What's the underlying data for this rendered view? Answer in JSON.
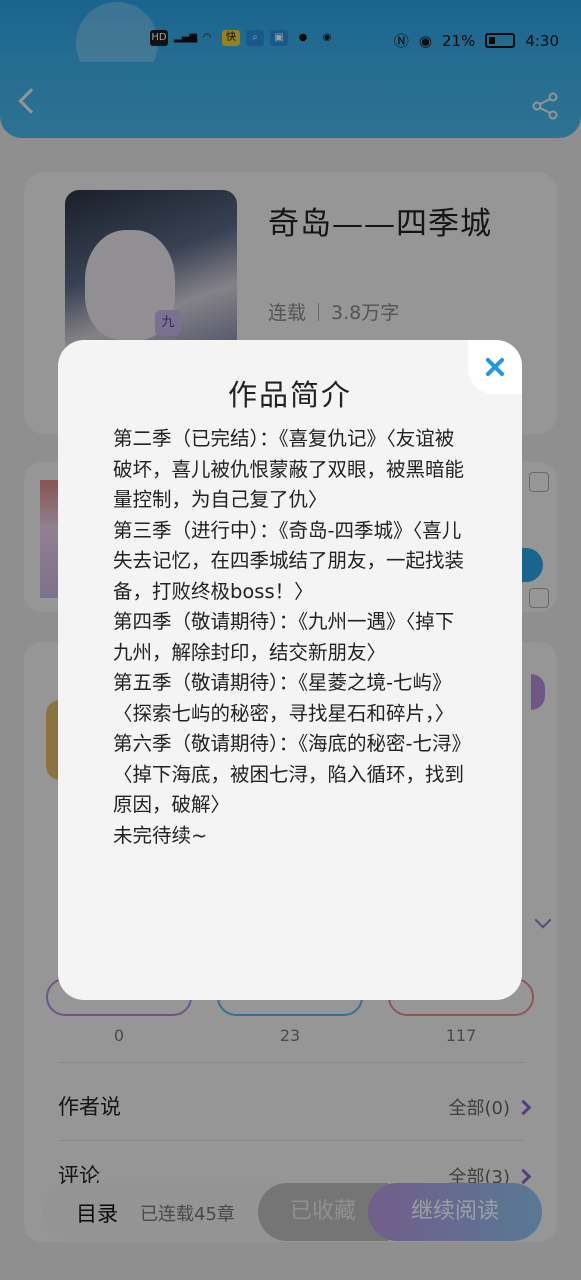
{
  "status_bar": {
    "time": "4:30",
    "battery": "21%",
    "icons": [
      "hd-icon",
      "signal-4g-icon",
      "wifi-icon",
      "quick-app-icon",
      "search-app-icon",
      "shopping-bag-icon",
      "qq-icon",
      "wechat-icon",
      "nfc-icon",
      "eye-icon",
      "battery-icon"
    ]
  },
  "header": {
    "back_icon": "back-arrow-icon",
    "share_icon": "share-icon"
  },
  "book": {
    "title": "奇岛——四季城",
    "status": "连载",
    "word_count": "3.8万字",
    "cover_badge": "九"
  },
  "stats": {
    "values": [
      "0",
      "23",
      "117"
    ]
  },
  "rows": {
    "author_says": {
      "label": "作者说",
      "right": "全部(0)"
    },
    "comments": {
      "label": "评论",
      "right": "全部(3)"
    }
  },
  "bottom_bar": {
    "toc_label": "目录",
    "toc_count": "已连载45章",
    "favorited": "已收藏",
    "continue_reading": "继续阅读"
  },
  "modal": {
    "title": "作品简介",
    "paragraphs": [
      "第二季（已完结）：《喜复仇记》〈友谊被破坏，喜儿被仇恨蒙蔽了双眼，被黑暗能量控制，为自己复了仇〉",
      "第三季（进行中）：《奇岛-四季城》〈喜儿失去记忆，在四季城结了朋友，一起找装备，打败终极boss！〉",
      "第四季（敬请期待）：《九州一遇》〈掉下九州，解除封印，结交新朋友〉",
      "第五季（敬请期待）：《星菱之境-七屿》〈探索七屿的秘密，寻找星石和碎片，〉",
      "第六季（敬请期待）：《海底的秘密-七浔》〈掉下海底，被困七浔，陷入循环，找到原因，破解〉",
      "未完待续~"
    ]
  }
}
